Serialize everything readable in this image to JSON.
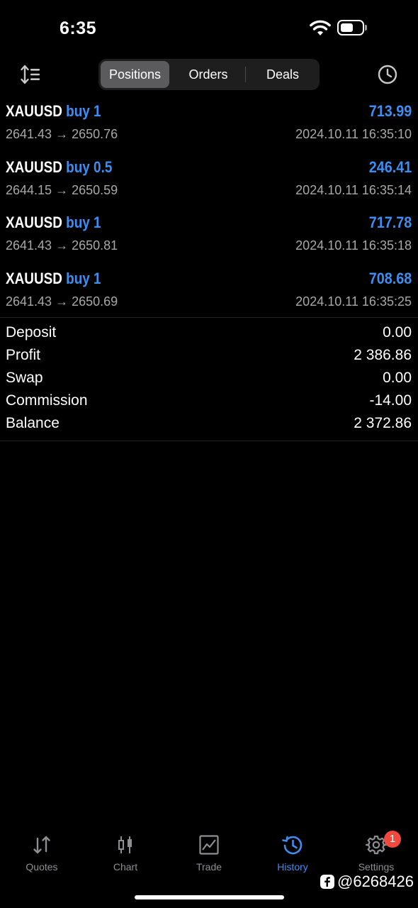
{
  "status_bar": {
    "time": "6:35",
    "battery_level": 0.6
  },
  "toolbar": {
    "sort_icon": "sort-icon",
    "history_period_icon": "clock-icon",
    "tabs": [
      {
        "label": "Positions",
        "selected": true
      },
      {
        "label": "Orders",
        "selected": false
      },
      {
        "label": "Deals",
        "selected": false
      }
    ]
  },
  "positions": [
    {
      "symbol": "XAUUSD",
      "side": "buy 1",
      "profit": "713.99",
      "prices": "2641.43 → 2650.76",
      "time": "2024.10.11 16:35:10"
    },
    {
      "symbol": "XAUUSD",
      "side": "buy 0.5",
      "profit": "246.41",
      "prices": "2644.15 → 2650.59",
      "time": "2024.10.11 16:35:14"
    },
    {
      "symbol": "XAUUSD",
      "side": "buy 1",
      "profit": "717.78",
      "prices": "2641.43 → 2650.81",
      "time": "2024.10.11 16:35:18"
    },
    {
      "symbol": "XAUUSD",
      "side": "buy 1",
      "profit": "708.68",
      "prices": "2641.43 → 2650.69",
      "time": "2024.10.11 16:35:25"
    }
  ],
  "summary": [
    {
      "label": "Deposit",
      "value": "0.00"
    },
    {
      "label": "Profit",
      "value": "2 386.86"
    },
    {
      "label": "Swap",
      "value": "0.00"
    },
    {
      "label": "Commission",
      "value": "-14.00"
    },
    {
      "label": "Balance",
      "value": "2 372.86"
    }
  ],
  "tabbar": {
    "items": [
      {
        "label": "Quotes",
        "icon": "quotes-arrows-icon",
        "active": false
      },
      {
        "label": "Chart",
        "icon": "candlestick-chart-icon",
        "active": false
      },
      {
        "label": "Trade",
        "icon": "trade-chart-icon",
        "active": false
      },
      {
        "label": "History",
        "icon": "history-icon",
        "active": true
      },
      {
        "label": "Settings",
        "icon": "gear-icon",
        "active": false,
        "badge": "1"
      }
    ]
  },
  "watermark": {
    "text": "@6268426",
    "icon": "facebook-icon"
  },
  "colors": {
    "accent": "#3d8ef0",
    "badge": "#f04a3f",
    "background": "#000000",
    "secondary_text": "#a8a8a8"
  }
}
